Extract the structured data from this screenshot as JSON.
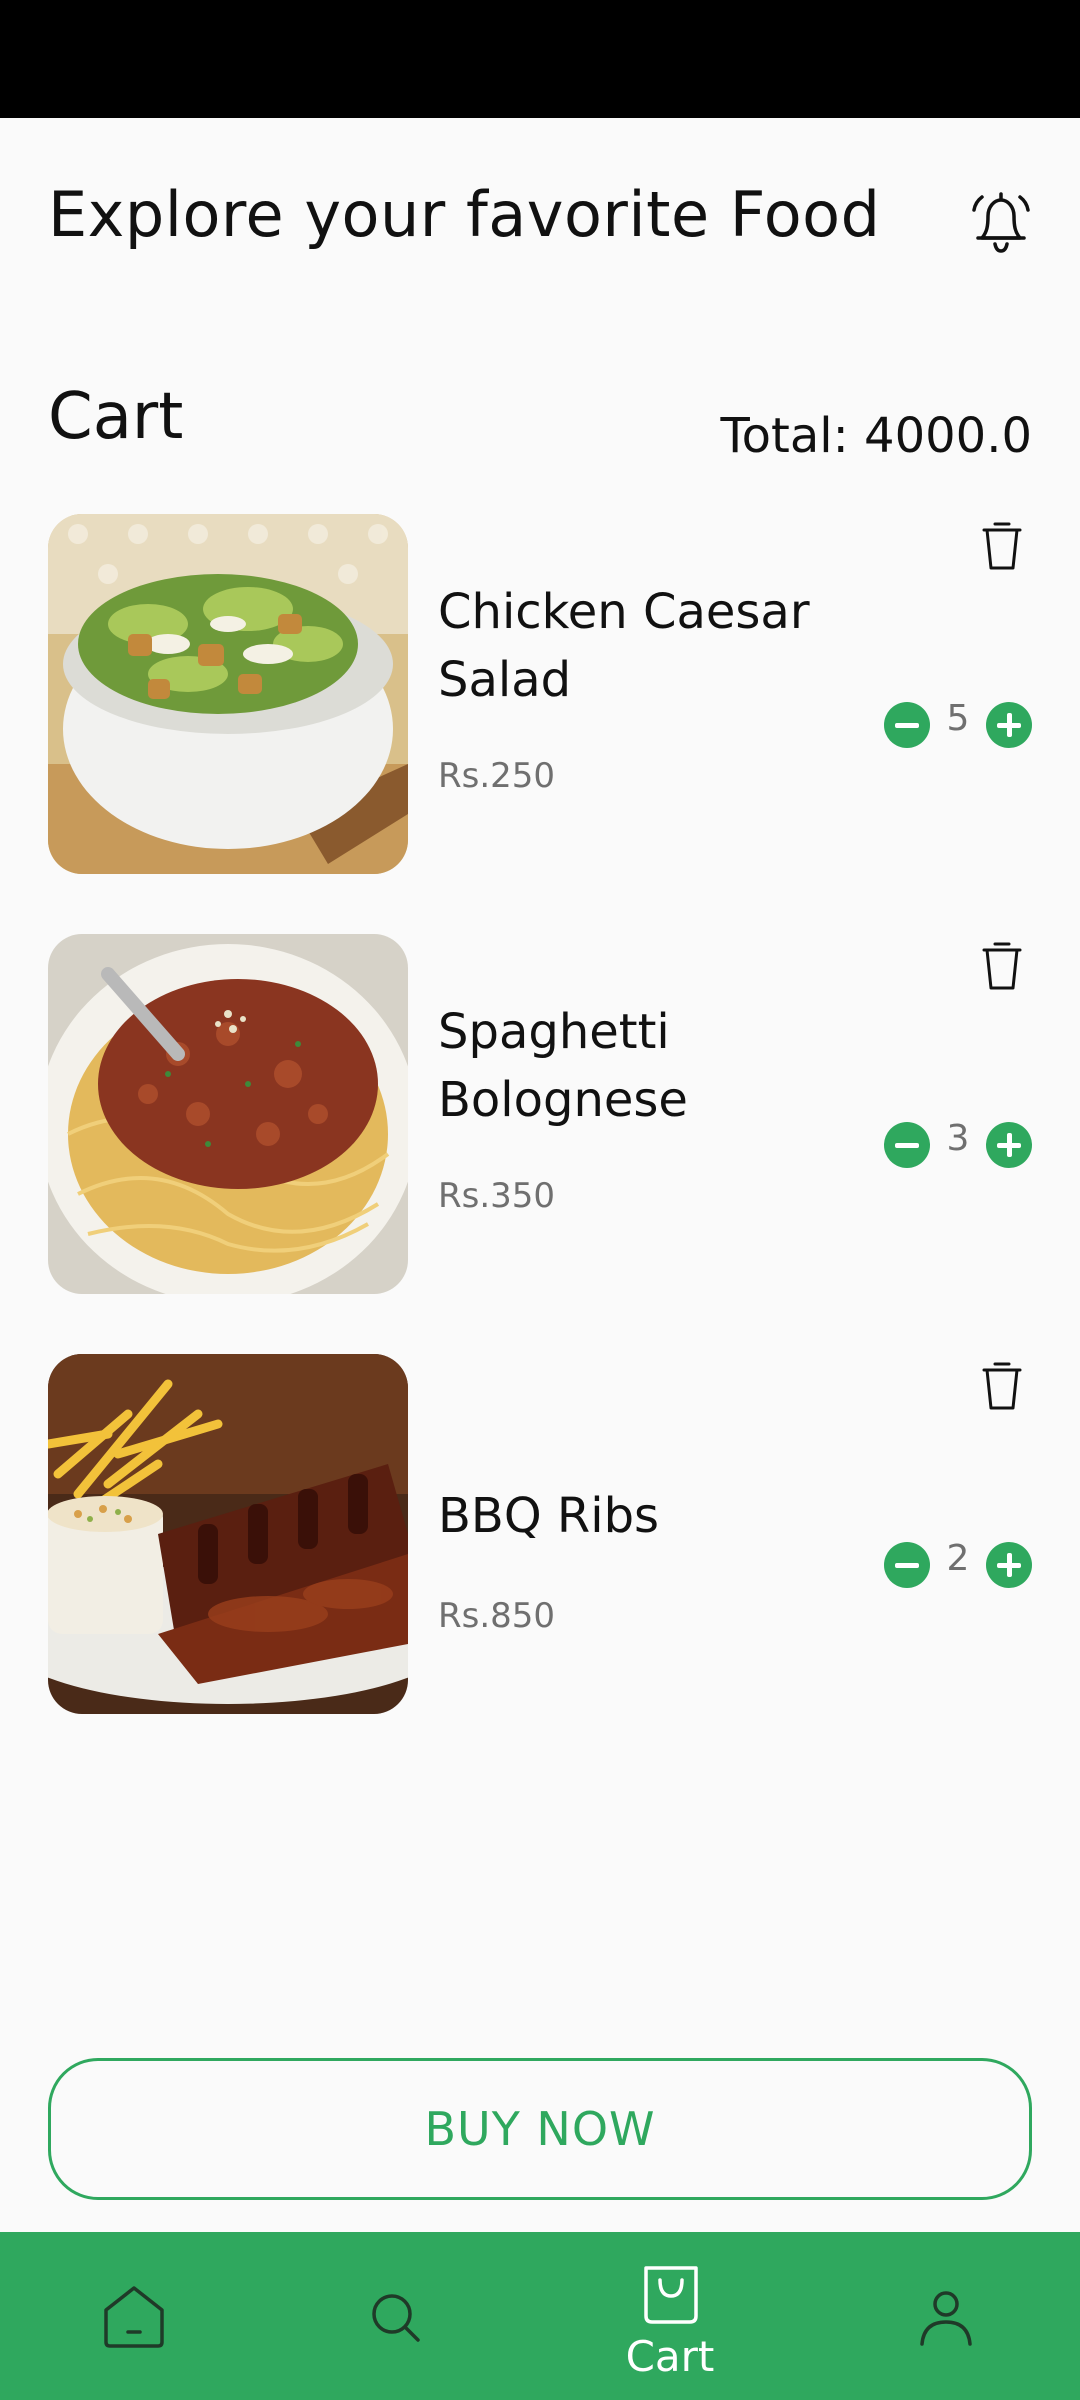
{
  "header": {
    "title": "Explore your favorite Food"
  },
  "cart": {
    "title": "Cart",
    "total": "Total: 4000.0",
    "items": [
      {
        "name": "Chicken Caesar Salad",
        "price": "Rs.250",
        "qty": "5"
      },
      {
        "name": "Spaghetti Bolognese",
        "price": "Rs.350",
        "qty": "3"
      },
      {
        "name": "BBQ Ribs",
        "price": "Rs.850",
        "qty": "2"
      }
    ]
  },
  "buy_now": "BUY NOW",
  "nav": {
    "cart_label": "Cart"
  },
  "icons": [
    "bell-icon",
    "trash-icon",
    "minus-icon",
    "plus-icon",
    "home-icon",
    "search-icon",
    "shopping-bag-icon",
    "profile-icon"
  ],
  "colors": {
    "accent": "#2fa85e",
    "background": "#fafafa",
    "status_bar": "#000000"
  }
}
